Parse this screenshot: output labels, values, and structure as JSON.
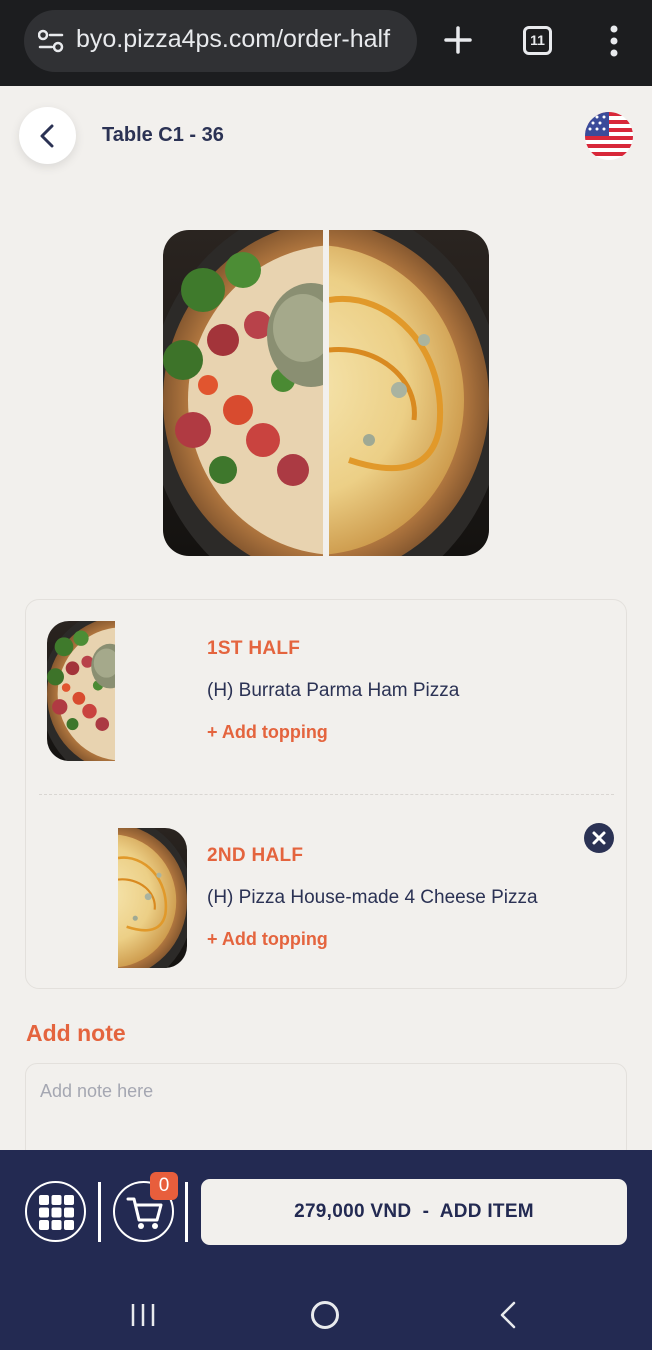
{
  "browser": {
    "url": "byo.pizza4ps.com/order-half",
    "tab_count": "11"
  },
  "header": {
    "table": "Table C1 - 36",
    "language_flag": "us-flag-icon"
  },
  "order": {
    "halves": [
      {
        "label": "1ST HALF",
        "name": "(H) Burrata Parma Ham Pizza",
        "add_topping": "+ Add topping"
      },
      {
        "label": "2ND HALF",
        "name": "(H) Pizza House-made 4 Cheese Pizza",
        "add_topping": "+ Add topping"
      }
    ]
  },
  "note": {
    "title": "Add note",
    "placeholder": "Add note here"
  },
  "bottom": {
    "cart_count": "0",
    "add_item_label": "279,000 VND  -  ADD ITEM"
  },
  "colors": {
    "accent": "#e4643e",
    "navy": "#232a52",
    "background": "#f2f0ed"
  }
}
